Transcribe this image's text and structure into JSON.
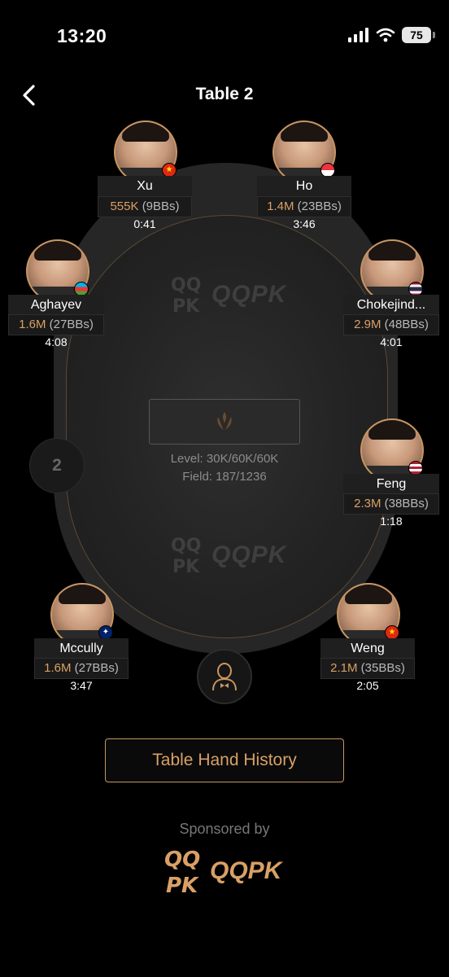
{
  "status_bar": {
    "time": "13:20",
    "battery": "75"
  },
  "header": {
    "title": "Table 2"
  },
  "table": {
    "watermark": "QQPK",
    "level": "Level: 30K/60K/60K",
    "field": "Field: 187/1236",
    "table_number": "2"
  },
  "players": [
    {
      "name": "Xu",
      "stack": "555K",
      "bbs": "(9BBs)",
      "timer": "0:41"
    },
    {
      "name": "Ho",
      "stack": "1.4M",
      "bbs": "(23BBs)",
      "timer": "3:46"
    },
    {
      "name": "Aghayev",
      "stack": "1.6M",
      "bbs": "(27BBs)",
      "timer": "4:08"
    },
    {
      "name": "Chokejind...",
      "stack": "2.9M",
      "bbs": "(48BBs)",
      "timer": "4:01"
    },
    {
      "name": "Feng",
      "stack": "2.3M",
      "bbs": "(38BBs)",
      "timer": "1:18"
    },
    {
      "name": "Mccully",
      "stack": "1.6M",
      "bbs": "(27BBs)",
      "timer": "3:47"
    },
    {
      "name": "Weng",
      "stack": "2.1M",
      "bbs": "(35BBs)",
      "timer": "2:05"
    }
  ],
  "actions": {
    "history_label": "Table Hand History"
  },
  "sponsor": {
    "label": "Sponsored by",
    "name": "QQPK"
  },
  "colors": {
    "accent": "#d9a066",
    "background": "#000000",
    "felt": "#232323"
  }
}
